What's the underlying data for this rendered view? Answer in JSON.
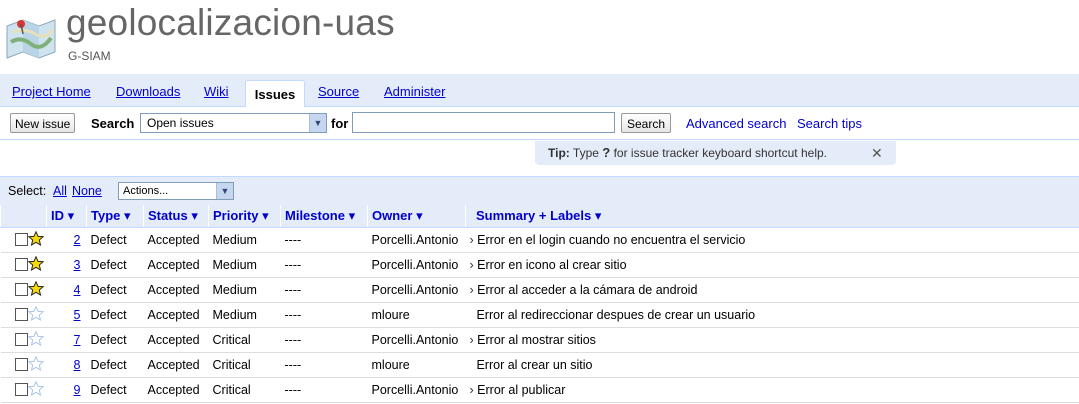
{
  "project": {
    "name": "geolocalizacion-uas",
    "summary": "G-SIAM"
  },
  "tabs": [
    {
      "label": "Project Home"
    },
    {
      "label": "Downloads"
    },
    {
      "label": "Wiki"
    },
    {
      "label": "Issues",
      "active": true
    },
    {
      "label": "Source"
    },
    {
      "label": "Administer"
    }
  ],
  "search": {
    "new_issue_label": "New issue",
    "search_label": "Search",
    "scope_value": "Open issues",
    "for_label": "for",
    "query_value": "",
    "search_button": "Search",
    "advanced_link": "Advanced search",
    "tips_link": "Search tips"
  },
  "tip": {
    "prefix": "Tip:",
    "text_before": "Type",
    "key": "?",
    "text_after": "for issue tracker keyboard shortcut help.",
    "close_icon": "x-icon"
  },
  "selection": {
    "label": "Select:",
    "all": "All",
    "none": "None",
    "actions_value": "Actions..."
  },
  "columns": [
    "ID",
    "Type",
    "Status",
    "Priority",
    "Milestone",
    "Owner",
    "Summary + Labels"
  ],
  "colors": {
    "accent_bg": "#e5ecf9",
    "border": "#c3d9ff",
    "link": "#0000cc",
    "star_filled": "#f5d90a"
  },
  "issues": [
    {
      "starred": true,
      "id": "2",
      "type": "Defect",
      "status": "Accepted",
      "priority": "Medium",
      "milestone": "----",
      "owner": "Porcelli.Antonio",
      "summary": "Error en el login cuando no encuentra el servicio"
    },
    {
      "starred": true,
      "id": "3",
      "type": "Defect",
      "status": "Accepted",
      "priority": "Medium",
      "milestone": "----",
      "owner": "Porcelli.Antonio",
      "summary": "Error en icono al crear sitio"
    },
    {
      "starred": true,
      "id": "4",
      "type": "Defect",
      "status": "Accepted",
      "priority": "Medium",
      "milestone": "----",
      "owner": "Porcelli.Antonio",
      "summary": "Error al acceder a la cámara de android"
    },
    {
      "starred": false,
      "id": "5",
      "type": "Defect",
      "status": "Accepted",
      "priority": "Medium",
      "milestone": "----",
      "owner": "mloure",
      "summary": "Error al redireccionar despues de crear un usuario"
    },
    {
      "starred": false,
      "id": "7",
      "type": "Defect",
      "status": "Accepted",
      "priority": "Critical",
      "milestone": "----",
      "owner": "Porcelli.Antonio",
      "summary": "Error al mostrar sitios"
    },
    {
      "starred": false,
      "id": "8",
      "type": "Defect",
      "status": "Accepted",
      "priority": "Critical",
      "milestone": "----",
      "owner": "mloure",
      "summary": "Error al crear un sitio"
    },
    {
      "starred": false,
      "id": "9",
      "type": "Defect",
      "status": "Accepted",
      "priority": "Critical",
      "milestone": "----",
      "owner": "Porcelli.Antonio",
      "summary": "Error al publicar"
    }
  ]
}
